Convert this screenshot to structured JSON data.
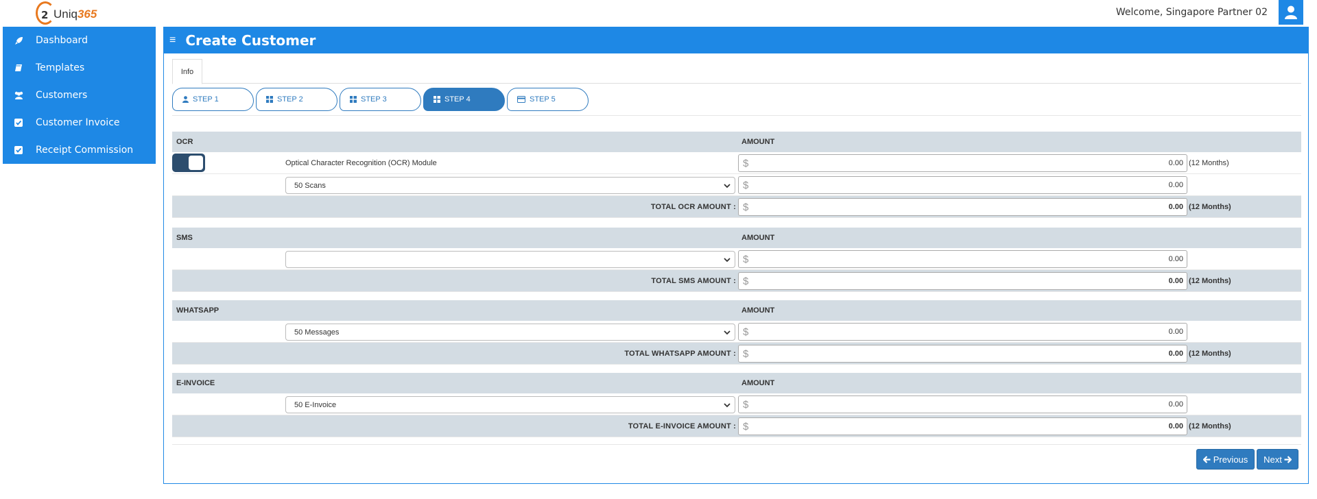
{
  "header": {
    "logo_text_plain": "Uniq",
    "logo_text_accent": "365",
    "welcome": "Welcome, Singapore Partner 02",
    "user_icon": "user-icon"
  },
  "sidebar": {
    "items": [
      {
        "label": "Dashboard",
        "icon": "rocket-icon"
      },
      {
        "label": "Templates",
        "icon": "book-icon"
      },
      {
        "label": "Customers",
        "icon": "users-icon"
      },
      {
        "label": "Customer Invoice",
        "icon": "check-square-icon"
      },
      {
        "label": "Receipt Commission",
        "icon": "check-square-icon"
      }
    ]
  },
  "page": {
    "title": "Create Customer",
    "tab": "Info",
    "steps": [
      "STEP 1",
      "STEP 2",
      "STEP 3",
      "STEP 4",
      "STEP 5"
    ],
    "active_step": 4
  },
  "ocr": {
    "section": "OCR",
    "amount_header": "AMOUNT",
    "toggle_on": true,
    "module_label": "Optical Character Recognition (OCR) Module",
    "module_amount": "0.00",
    "module_months": "(12 Months)",
    "select_value": "50 Scans",
    "select_amount": "0.00",
    "total_label": "TOTAL OCR AMOUNT :",
    "total_amount": "0.00",
    "total_months": "(12 Months)"
  },
  "sms": {
    "section": "SMS",
    "amount_header": "AMOUNT",
    "select_value": "",
    "select_amount": "0.00",
    "total_label": "TOTAL SMS AMOUNT :",
    "total_amount": "0.00",
    "total_months": "(12 Months)"
  },
  "whatsapp": {
    "section": "WHATSAPP",
    "amount_header": "AMOUNT",
    "select_value": "50 Messages",
    "select_amount": "0.00",
    "total_label": "TOTAL WHATSAPP AMOUNT :",
    "total_amount": "0.00",
    "total_months": "(12 Months)"
  },
  "einvoice": {
    "section": "E-INVOICE",
    "amount_header": "AMOUNT",
    "select_value": "50 E-Invoice",
    "select_amount": "0.00",
    "total_label": "TOTAL E-INVOICE AMOUNT :",
    "total_amount": "0.00",
    "total_months": "(12 Months)"
  },
  "currency_symbol": "$",
  "buttons": {
    "previous": "Previous",
    "next": "Next"
  },
  "colors": {
    "primary": "#1e88e5",
    "step": "#2f7bbf",
    "section_bg": "#d3dce3",
    "toggle": "#2c4d6e",
    "logo_accent": "#e8791f"
  }
}
